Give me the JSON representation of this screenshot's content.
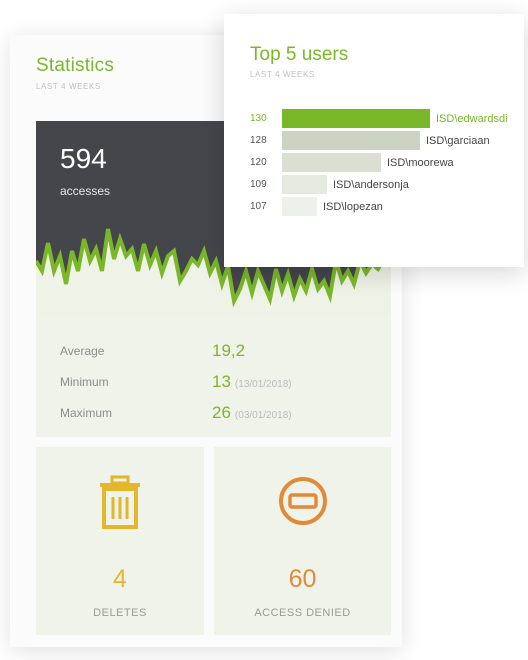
{
  "statistics": {
    "title": "Statistics",
    "subtitle": "LAST 4 WEEKS",
    "accesses_count": "594",
    "accesses_label": "accesses",
    "metrics": [
      {
        "label": "Average",
        "value": "19,2",
        "date": ""
      },
      {
        "label": "Minimum",
        "value": "13",
        "date": "(13/01/2018)"
      },
      {
        "label": "Maximum",
        "value": "26",
        "date": "(03/01/2018)"
      }
    ]
  },
  "tiles": {
    "deletes": {
      "value": "4",
      "label": "DELETES",
      "icon": "trash-icon",
      "color": "#e3b62c"
    },
    "denied": {
      "value": "60",
      "label": "ACCESS DENIED",
      "icon": "minus-circle-icon",
      "color": "#e08a3a"
    }
  },
  "top_users": {
    "title": "Top 5 users",
    "subtitle": "LAST 4 WEEKS",
    "users": [
      {
        "count": "130",
        "name": "ISD\\edwardsdi",
        "value": 130
      },
      {
        "count": "128",
        "name": "ISD\\garciaan",
        "value": 128
      },
      {
        "count": "120",
        "name": "ISD\\moorewa",
        "value": 120
      },
      {
        "count": "109",
        "name": "ISD\\andersonja",
        "value": 109
      },
      {
        "count": "107",
        "name": "ISD\\lopezan",
        "value": 107
      }
    ]
  },
  "colors": {
    "accent": "#7ab82a",
    "dark_panel": "#44464c",
    "tile_background": "#f0f3ea"
  }
}
